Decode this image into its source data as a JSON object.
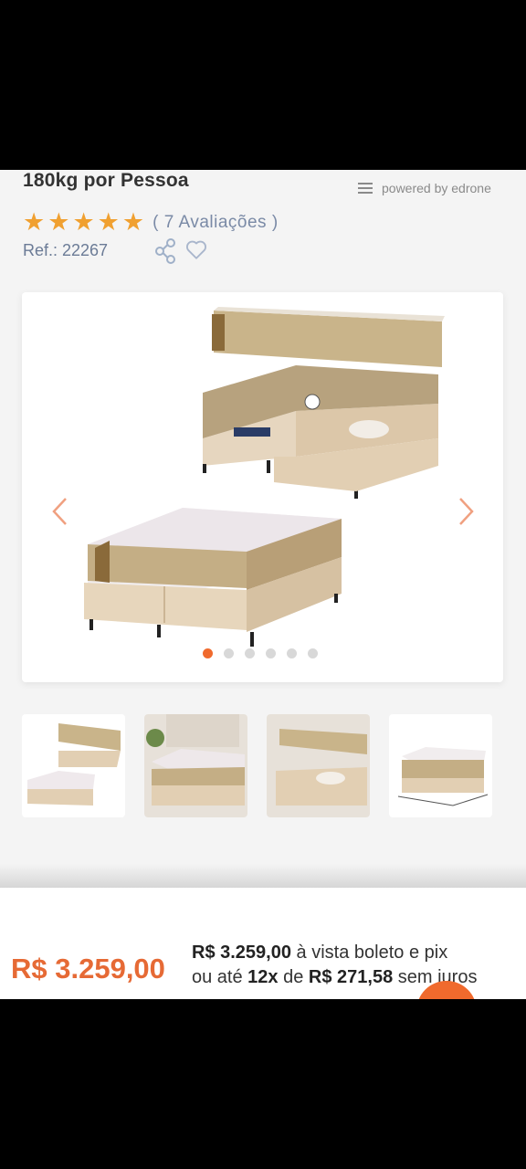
{
  "product": {
    "title": "180kg por Pessoa",
    "rating": {
      "stars": 5,
      "reviews_text": "( 7 Avaliações )"
    },
    "ref_text": "Ref.: 22267"
  },
  "widget": {
    "powered_by": "powered by edrone"
  },
  "gallery": {
    "slide_count": 6,
    "active_slide": 0,
    "thumbnail_count": 4
  },
  "price": {
    "main": "R$ 3.259,00",
    "cash_value": "R$ 3.259,00",
    "cash_suffix": " à vista boleto e pix",
    "installment_prefix": "ou até ",
    "installment_count": "12x",
    "installment_mid": " de ",
    "installment_value": "R$ 271,58",
    "installment_suffix": " sem juros"
  },
  "colors": {
    "accent": "#f06a2d",
    "price": "#e66a35",
    "star": "#f0a030"
  }
}
